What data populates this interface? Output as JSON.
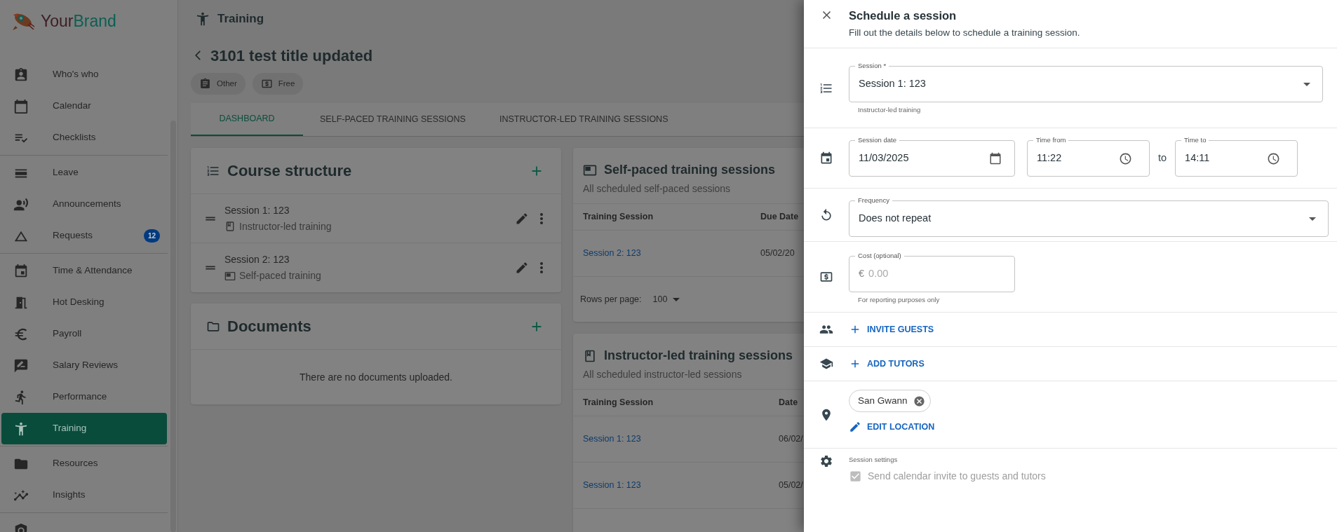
{
  "brand": {
    "first": "Your",
    "second": "Brand"
  },
  "sidebar": {
    "groups": [
      [
        {
          "label": "Who's who",
          "selected": false
        },
        {
          "label": "Calendar",
          "selected": false
        },
        {
          "label": "Checklists",
          "selected": false
        }
      ],
      [
        {
          "label": "Leave",
          "selected": false
        },
        {
          "label": "Announcements",
          "selected": false
        },
        {
          "label": "Requests",
          "selected": false,
          "badge": "12"
        }
      ],
      [
        {
          "label": "Time & Attendance",
          "selected": false
        },
        {
          "label": "Hot Desking",
          "selected": false
        },
        {
          "label": "Payroll",
          "selected": false
        },
        {
          "label": "Salary Reviews",
          "selected": false
        },
        {
          "label": "Performance",
          "selected": false
        },
        {
          "label": "Training",
          "selected": true
        }
      ],
      [
        {
          "label": "Resources",
          "selected": false
        },
        {
          "label": "Insights",
          "selected": false
        }
      ],
      [
        {
          "selected": false
        }
      ]
    ]
  },
  "header": {
    "section": "Training"
  },
  "course": {
    "title": "3101 test title updated",
    "chips": [
      "Other",
      "Free"
    ]
  },
  "tabs": [
    {
      "label": "DASHBOARD",
      "selected": true
    },
    {
      "label": "SELF-PACED TRAINING SESSIONS",
      "selected": false
    },
    {
      "label": "INSTRUCTOR-LED TRAINING SESSIONS",
      "selected": false
    }
  ],
  "course_structure": {
    "title": "Course structure",
    "items": [
      {
        "title": "Session 1: 123",
        "type": "Instructor-led training",
        "kind": "instructor"
      },
      {
        "title": "Session 2: 123",
        "type": "Self-paced training",
        "kind": "self"
      }
    ]
  },
  "documents": {
    "title": "Documents",
    "empty": "There are no documents uploaded."
  },
  "self_paced": {
    "title": "Self-paced training sessions",
    "subtitle": "All scheduled self-paced sessions",
    "columns": [
      "Training Session",
      "Due Date"
    ],
    "rows": [
      [
        "Session 2: 123",
        "05/02/20"
      ]
    ],
    "rows_per_page": {
      "label": "Rows per page:",
      "value": "100"
    }
  },
  "instructor_led": {
    "title": "Instructor-led training sessions",
    "subtitle": "All scheduled instructor-led sessions",
    "columns": [
      "Training Session",
      "Date"
    ],
    "rows": [
      [
        "Session 1: 123",
        "06/02/"
      ],
      [
        "Session 1: 123",
        "05/02/"
      ]
    ]
  },
  "drawer": {
    "title": "Schedule a session",
    "subtitle": "Fill out the details below to schedule a training session.",
    "session": {
      "label": "Session *",
      "value": "Session 1: 123",
      "helper": "Instructor-led training"
    },
    "date": {
      "label": "Session date",
      "value": "11/03/2025"
    },
    "time_from": {
      "label": "Time from",
      "value": "11:22"
    },
    "separator": "to",
    "time_to": {
      "label": "Time to",
      "value": "14:11"
    },
    "frequency": {
      "label": "Frequency",
      "value": "Does not repeat"
    },
    "cost": {
      "label": "Cost (optional)",
      "currency": "€",
      "placeholder": "0.00",
      "helper": "For reporting purposes only"
    },
    "invite_guests": "INVITE GUESTS",
    "add_tutors": "ADD TUTORS",
    "location": {
      "chip": "San Gwann",
      "edit": "EDIT LOCATION"
    },
    "settings": {
      "label": "Session settings",
      "checkbox": {
        "label": "Send calendar invite to guests and tutors",
        "checked": true,
        "disabled": true
      }
    }
  }
}
